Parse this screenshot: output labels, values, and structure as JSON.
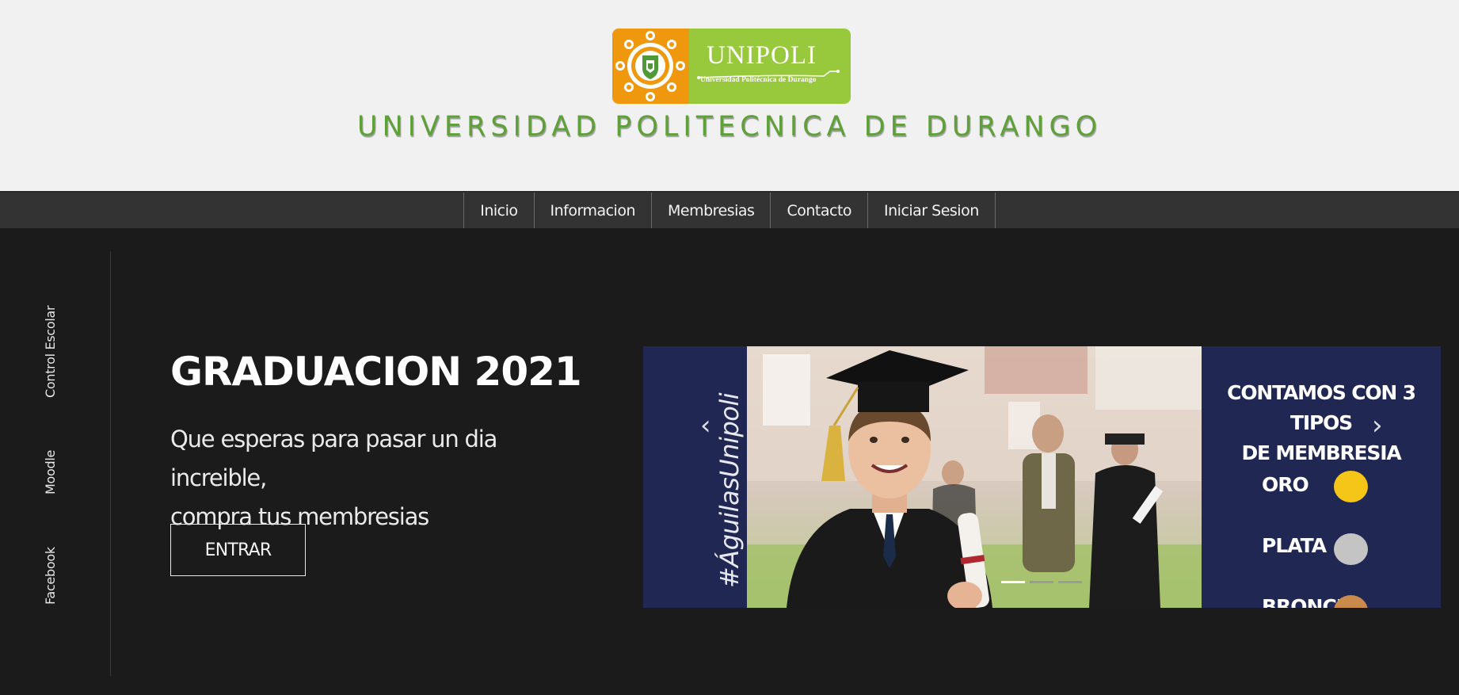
{
  "header": {
    "logo_title": "UNIPOLI",
    "logo_subtitle": "Universidad Politécnica de Durango",
    "site_title": "UNIVERSIDAD POLITECNICA DE DURANGO"
  },
  "nav": {
    "items": [
      {
        "label": "Inicio"
      },
      {
        "label": "Informacion"
      },
      {
        "label": "Membresias"
      },
      {
        "label": "Contacto"
      },
      {
        "label": "Iniciar Sesion"
      }
    ]
  },
  "side": {
    "links": [
      {
        "label": "Control Escolar"
      },
      {
        "label": "Moodle"
      },
      {
        "label": "Facebook"
      }
    ]
  },
  "hero": {
    "title": "GRADUACION 2021",
    "text_line1": "Que esperas para pasar un dia increible,",
    "text_line2": "compra tus membresias",
    "button_label": "ENTRAR"
  },
  "carousel": {
    "hashtag": "#ÁguilasUnipoli",
    "title_line1": "CONTAMOS CON 3 TIPOS",
    "title_line2": "DE MEMBRESIA",
    "tiers": [
      {
        "label": "ORO",
        "color": "#f5c518"
      },
      {
        "label": "PLATA",
        "color": "#c4c4c4"
      },
      {
        "label": "BRONCE",
        "color": "#c98a4b"
      }
    ],
    "prev_icon": "chevron-left-icon",
    "next_icon": "chevron-right-icon",
    "active_slide": 1,
    "slide_count": 3
  },
  "colors": {
    "header_bg": "#f1f1f1",
    "nav_bg": "#333333",
    "page_bg": "#1b1b1b",
    "title_green": "#5fa03a",
    "logo_orange": "#ef970d",
    "logo_green": "#98c93c",
    "carousel_navy": "#1f2752"
  }
}
